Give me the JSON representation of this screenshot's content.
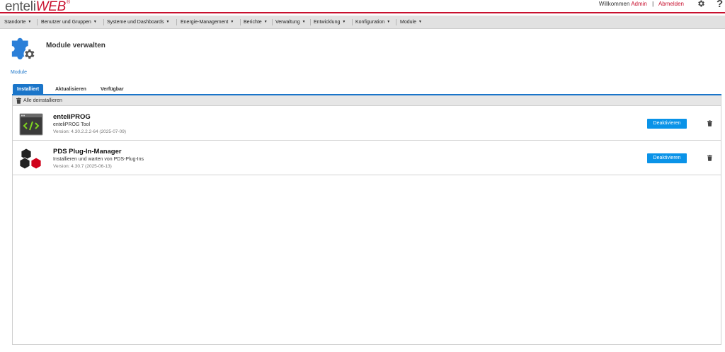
{
  "header": {
    "logo_part1": "enteli",
    "logo_part2": "WEB",
    "logo_mark": "®",
    "welcome_text": "Willkommen",
    "user": "Admin",
    "separator": "|",
    "logout": "Abmelden",
    "settings_icon": "gear-icon",
    "help_label": "?"
  },
  "nav": {
    "items": [
      {
        "label": "Standorte"
      },
      {
        "label": "Benutzer und Gruppen"
      },
      {
        "label": "Systeme und Dashboards"
      },
      {
        "label": "Energie-Management"
      },
      {
        "label": "Berichte"
      },
      {
        "label": "Verwaltung"
      },
      {
        "label": "Entwicklung"
      },
      {
        "label": "Konfiguration"
      },
      {
        "label": "Module"
      }
    ],
    "caret": "▼"
  },
  "page": {
    "title": "Module verwalten",
    "breadcrumb": "Module"
  },
  "tabs": [
    {
      "label": "Installiert",
      "active": true
    },
    {
      "label": "Aktualisieren",
      "active": false
    },
    {
      "label": "Verfügbar",
      "active": false
    }
  ],
  "toolbar": {
    "uninstall_all": "Alle deinstallieren"
  },
  "modules": [
    {
      "name": "enteliPROG",
      "description": "enteliPROG Tool",
      "version": "Version: 4.30.2.2.2-64 (2025-07-09)",
      "button": "Deaktivieren",
      "icon": "code-window-icon"
    },
    {
      "name": "PDS Plug-In-Manager",
      "description": "Installieren und warten von PDS-Plug-Ins",
      "version": "Version: 4.30.7 (2025-06-13)",
      "button": "Deaktivieren",
      "icon": "cubes-icon"
    }
  ],
  "colors": {
    "brand_red": "#c8102e",
    "accent_blue": "#1a75c9",
    "button_blue": "#0a93e8"
  }
}
